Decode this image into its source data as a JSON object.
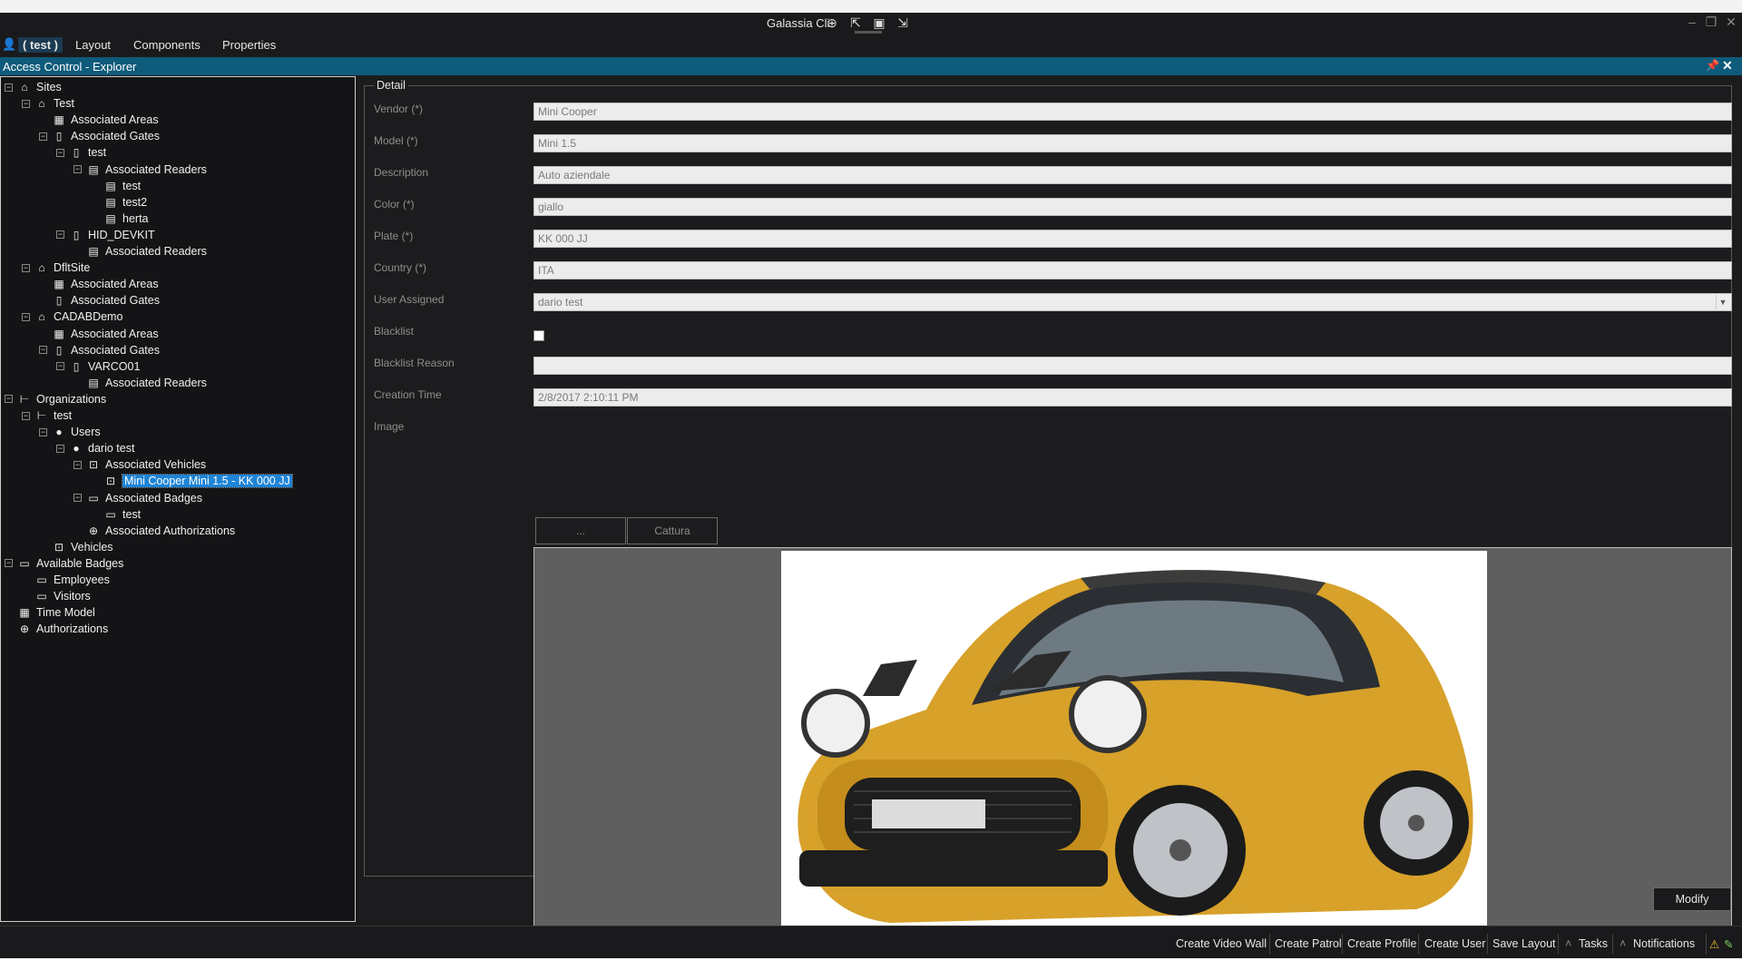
{
  "titlebar": {
    "title": "Galassia Cli",
    "icons": [
      "layout-add-icon",
      "pointer-icon",
      "frame-icon",
      "cursor-icon"
    ],
    "window_controls": [
      "minimize-icon",
      "restore-icon",
      "close-icon"
    ]
  },
  "menu": {
    "user": "( test )",
    "items": [
      "Layout",
      "Components",
      "Properties"
    ]
  },
  "panel": {
    "title": "Access Control - Explorer",
    "header_color": "#0e5b7b"
  },
  "tree": [
    {
      "label": "Sites",
      "icon": "home-icon",
      "expander": "minus"
    },
    {
      "label": "Test",
      "icon": "home-icon",
      "expander": "minus"
    },
    {
      "label": "Associated Areas",
      "icon": "area-icon",
      "expander": "none"
    },
    {
      "label": "Associated Gates",
      "icon": "gate-icon",
      "expander": "minus"
    },
    {
      "label": "test",
      "icon": "gate-icon",
      "expander": "minus"
    },
    {
      "label": "Associated Readers",
      "icon": "reader-icon",
      "expander": "minus"
    },
    {
      "label": "test",
      "icon": "reader-icon",
      "expander": "none"
    },
    {
      "label": "test2",
      "icon": "reader-icon",
      "expander": "none"
    },
    {
      "label": "herta",
      "icon": "reader-icon",
      "expander": "none"
    },
    {
      "label": "HID_DEVKIT",
      "icon": "gate-icon",
      "expander": "minus"
    },
    {
      "label": "Associated Readers",
      "icon": "reader-icon",
      "expander": "none"
    },
    {
      "label": "DfltSite",
      "icon": "home-icon",
      "expander": "minus"
    },
    {
      "label": "Associated Areas",
      "icon": "area-icon",
      "expander": "none"
    },
    {
      "label": "Associated Gates",
      "icon": "gate-icon",
      "expander": "none"
    },
    {
      "label": "CADABDemo",
      "icon": "home-icon",
      "expander": "minus"
    },
    {
      "label": "Associated Areas",
      "icon": "area-icon",
      "expander": "none"
    },
    {
      "label": "Associated Gates",
      "icon": "gate-icon",
      "expander": "minus"
    },
    {
      "label": "VARCO01",
      "icon": "gate-icon",
      "expander": "minus"
    },
    {
      "label": "Associated Readers",
      "icon": "reader-icon",
      "expander": "none"
    },
    {
      "label": "Organizations",
      "icon": "org-icon",
      "expander": "minus"
    },
    {
      "label": "test",
      "icon": "org-icon",
      "expander": "minus"
    },
    {
      "label": "Users",
      "icon": "user-icon",
      "expander": "minus"
    },
    {
      "label": "dario test",
      "icon": "user-icon",
      "expander": "minus"
    },
    {
      "label": "Associated Vehicles",
      "icon": "car-icon",
      "expander": "minus"
    },
    {
      "label": "Mini Cooper Mini 1.5 - KK 000 JJ",
      "icon": "car-icon",
      "expander": "none",
      "selected": true
    },
    {
      "label": "Associated Badges",
      "icon": "badge-icon",
      "expander": "minus"
    },
    {
      "label": "test",
      "icon": "badge-icon",
      "expander": "none"
    },
    {
      "label": "Associated Authorizations",
      "icon": "lock-icon",
      "expander": "none"
    },
    {
      "label": "Vehicles",
      "icon": "car-icon",
      "expander": "none"
    },
    {
      "label": "Available Badges",
      "icon": "badge-icon",
      "expander": "minus"
    },
    {
      "label": "Employees",
      "icon": "badge-icon",
      "expander": "none"
    },
    {
      "label": "Visitors",
      "icon": "badge-icon",
      "expander": "none"
    },
    {
      "label": "Time Model",
      "icon": "calendar-icon",
      "expander": "none"
    },
    {
      "label": "Authorizations",
      "icon": "lock-icon",
      "expander": "none"
    }
  ],
  "detail": {
    "group_title": "Detail",
    "fields": [
      {
        "label": "Vendor (*)",
        "value": "Mini Cooper"
      },
      {
        "label": "Model (*)",
        "value": "Mini 1.5"
      },
      {
        "label": "Description",
        "value": "Auto aziendale"
      },
      {
        "label": "Color (*)",
        "value": "giallo"
      },
      {
        "label": "Plate (*)",
        "value": "KK 000 JJ"
      },
      {
        "label": "Country (*)",
        "value": "ITA"
      },
      {
        "label": "User Assigned",
        "value": "dario test"
      }
    ],
    "blacklist_label": "Blacklist",
    "blacklist_checked": false,
    "blacklist_reason_label": "Blacklist Reason",
    "blacklist_reason_value": "",
    "creation_time_label": "Creation Time",
    "creation_time_value": "2/8/2017 2:10:11 PM",
    "image_label": "Image",
    "image_buttons": [
      "...",
      "Cattura"
    ],
    "modify_label": "Modify"
  },
  "statusbar": {
    "buttons": [
      "Create Video Wall",
      "Create Patrol",
      "Create Profile",
      "Create User",
      "Save Layout",
      "Tasks",
      "Notifications"
    ],
    "icons": [
      "warning-icon",
      "edit-icon"
    ]
  }
}
